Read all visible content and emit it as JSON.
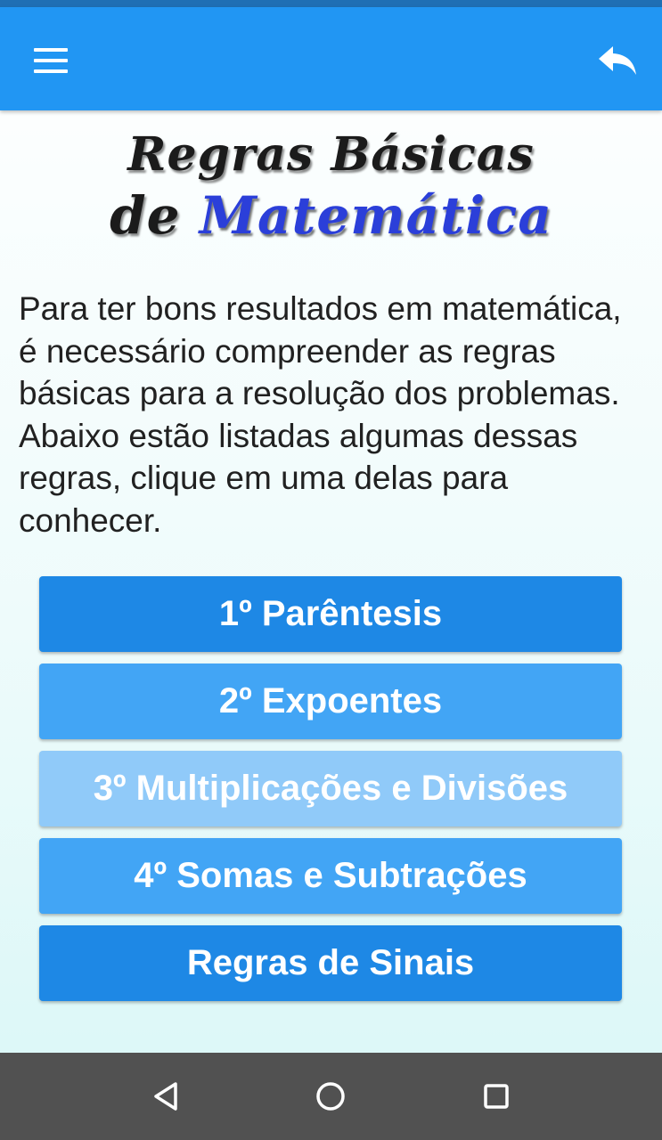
{
  "app_bar": {
    "color": "#2196f3",
    "menu_icon": "hamburger-menu-icon",
    "back_icon": "reply-arrow-icon"
  },
  "logo": {
    "line1": "Regras Básicas",
    "line2_part1": "de",
    "line2_part2": "Matemática"
  },
  "intro_text": "Para ter bons resultados em matemática, é necessário compreender as regras básicas para a resolução dos problemas. Abaixo estão listadas algumas dessas regras, clique em uma delas para conhecer.",
  "rules": [
    {
      "label": "1º Parêntesis",
      "color": "#1e88e5"
    },
    {
      "label": "2º Expoentes",
      "color": "#42a5f5"
    },
    {
      "label": "3º Multiplicações e Divisões",
      "color": "#90caf9"
    },
    {
      "label": "4º Somas e Subtrações",
      "color": "#42a5f5"
    },
    {
      "label": "Regras de Sinais",
      "color": "#1e88e5"
    }
  ],
  "nav_bar": {
    "back": "triangle-back-icon",
    "home": "circle-home-icon",
    "recents": "square-recents-icon"
  }
}
